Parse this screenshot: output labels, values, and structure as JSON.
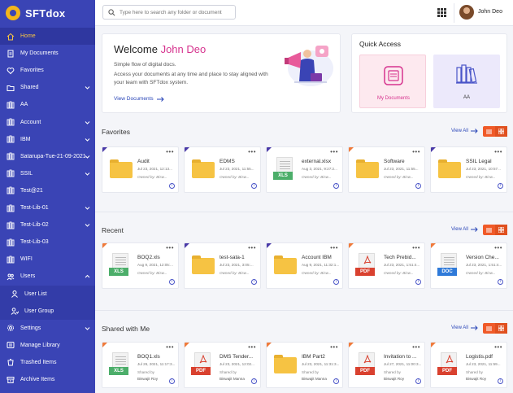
{
  "app": {
    "name": "SFTdox"
  },
  "sidebar": {
    "items": [
      {
        "label": "Home",
        "icon": "home-icon",
        "active": true
      },
      {
        "label": "My Documents",
        "icon": "document-icon"
      },
      {
        "label": "Favorites",
        "icon": "heart-icon"
      },
      {
        "label": "Shared",
        "icon": "shared-folder-icon",
        "expandable": true
      },
      {
        "label": "AA",
        "icon": "library-icon"
      },
      {
        "label": "Account",
        "icon": "library-icon",
        "expandable": true
      },
      {
        "label": "IBM",
        "icon": "library-icon",
        "expandable": true
      },
      {
        "label": "Satarupa-Tue-21-09-2021",
        "icon": "library-icon",
        "expandable": true
      },
      {
        "label": "SSIL",
        "icon": "library-icon",
        "expandable": true
      },
      {
        "label": "Test@21",
        "icon": "library-icon"
      },
      {
        "label": "Test-Lib-01",
        "icon": "library-icon",
        "expandable": true
      },
      {
        "label": "Test-Lib-02",
        "icon": "library-icon",
        "expandable": true
      },
      {
        "label": "Test-Lib-03",
        "icon": "library-icon"
      },
      {
        "label": "WIFI",
        "icon": "library-icon"
      },
      {
        "label": "Users",
        "icon": "users-icon",
        "expandable": true,
        "expanded": true
      },
      {
        "label": "User List",
        "icon": "user-icon",
        "sub": true
      },
      {
        "label": "User Group",
        "icon": "user-group-icon",
        "sub": true
      },
      {
        "label": "Settings",
        "icon": "gear-icon",
        "expandable": true
      },
      {
        "label": "Manage Library",
        "icon": "manage-library-icon"
      },
      {
        "label": "Trashed Items",
        "icon": "trash-icon"
      },
      {
        "label": "Archive Items",
        "icon": "archive-icon"
      }
    ]
  },
  "topbar": {
    "search_placeholder": "Type here to search any folder or document",
    "user_name": "John Deo"
  },
  "welcome": {
    "greeting": "Welcome",
    "name": "John Deo",
    "line1": "Simple flow of digital docs.",
    "line2": "Access your documents at any time and place to stay aligned with your team with SFTdox system.",
    "link": "View Documents"
  },
  "quick_access": {
    "title": "Quick Access",
    "tiles": [
      {
        "label": "My Documents",
        "color": "#fde9ef",
        "text_color": "#d6338e"
      },
      {
        "label": "AA",
        "color": "#ece9fb",
        "text_color": "#333"
      }
    ]
  },
  "sections": {
    "view_all": "View All",
    "favorites": {
      "title": "Favorites",
      "items": [
        {
          "name": "Audit",
          "date": "Jul 23, 2021, 12:13...",
          "owner": "Owned by: Bisw...",
          "type": "folder",
          "corner": "purple"
        },
        {
          "name": "EDMS",
          "date": "Jul 23, 2021, 11:55...",
          "owner": "Owned by: Bisw...",
          "type": "folder",
          "corner": "purple"
        },
        {
          "name": "external.xlsx",
          "date": "Aug 3, 2021, 9:27:2...",
          "owner": "Owned by: Bisw...",
          "type": "xls",
          "badge": "XLS",
          "corner": "purple"
        },
        {
          "name": "Software",
          "date": "Jul 23, 2021, 11:55...",
          "owner": "Owned by: Bisw...",
          "type": "folder",
          "corner": "orange"
        },
        {
          "name": "SSIL Legal",
          "date": "Jul 23, 2021, 10:57...",
          "owner": "Owned by: Bisw...",
          "type": "folder",
          "corner": "purple"
        }
      ]
    },
    "recent": {
      "title": "Recent",
      "items": [
        {
          "name": "BOQ2.xls",
          "date": "Aug 9, 2021, 12:05:...",
          "owner": "Owned by: Bisw...",
          "type": "xls",
          "badge": "XLS",
          "corner": "orange"
        },
        {
          "name": "test-sata-1",
          "date": "Jul 23, 2021, 3:05:...",
          "owner": "Owned by: Bisw...",
          "type": "folder",
          "corner": "purple"
        },
        {
          "name": "Account IBM",
          "date": "Aug 9, 2021, 11:32:1...",
          "owner": "Owned by: Bisw...",
          "type": "folder",
          "corner": "purple"
        },
        {
          "name": "Tech Prebid...",
          "date": "Jul 23, 2021, 1:51:4...",
          "owner": "Owned by: Bisw...",
          "type": "pdf",
          "badge": "PDF",
          "corner": "orange"
        },
        {
          "name": "Version Che...",
          "date": "Jul 23, 2021, 1:51:4...",
          "owner": "Owned by: Bisw...",
          "type": "doc",
          "badge": "DOC",
          "corner": "orange"
        }
      ]
    },
    "shared": {
      "title": "Shared with Me",
      "items": [
        {
          "name": "BOQ1.xls",
          "date": "Jul 26, 2021, 11:17:3...",
          "owner": "Shared by",
          "owner2": "Biswajit Roy",
          "type": "xls",
          "badge": "XLS",
          "corner": "orange"
        },
        {
          "name": "DMS Tender...",
          "date": "Jul 23, 2021, 12:02...",
          "owner": "Shared by",
          "owner2": "Biswajit Manna",
          "type": "pdf",
          "badge": "PDF",
          "corner": "orange"
        },
        {
          "name": "IBM Part2",
          "date": "Jul 23, 2021, 11:31:3...",
          "owner": "Shared by",
          "owner2": "Biswajit Manna",
          "type": "folder",
          "corner": "orange"
        },
        {
          "name": "Invitation to ...",
          "date": "Jul 27, 2021, 11:00:3...",
          "owner": "Shared by",
          "owner2": "Biswajit Roy",
          "type": "pdf",
          "badge": "PDF",
          "corner": "orange"
        },
        {
          "name": "Logistis.pdf",
          "date": "Jul 23, 2021, 11:59...",
          "owner": "Shared by",
          "owner2": "Biswajit Roy",
          "type": "pdf",
          "badge": "PDF",
          "corner": "orange"
        }
      ]
    }
  }
}
